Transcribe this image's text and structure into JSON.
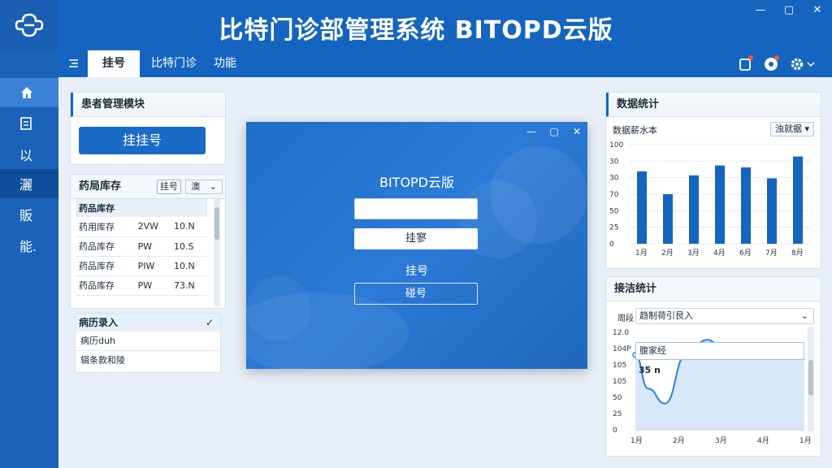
{
  "app": {
    "title": "比特门诊部管理系统 BITOPD云版"
  },
  "window_controls": {
    "minimize": "—",
    "maximize": "▢",
    "close": "✕"
  },
  "tabs": [
    {
      "label": "挂号",
      "active": true
    },
    {
      "label": "比特门诊",
      "active": false
    },
    {
      "label": "功能",
      "active": false
    }
  ],
  "nav": [
    {
      "label": "",
      "icon": "home-icon"
    },
    {
      "label": "",
      "icon": "document-icon"
    },
    {
      "label": "以"
    },
    {
      "label": "灑"
    },
    {
      "label": "販"
    },
    {
      "label": "能."
    }
  ],
  "patient_panel": {
    "title": "患者管理模块",
    "button": "挂挂号"
  },
  "pharmacy": {
    "title": "药局库存",
    "btn1": "挂号",
    "btn2": "澳",
    "header": "药品库存",
    "rows": [
      {
        "name": "药用库存",
        "unit": "2VW",
        "qty": "10.N"
      },
      {
        "name": "药品库存",
        "unit": "PW",
        "qty": "10.S"
      },
      {
        "name": "药品库存",
        "unit": "PIW",
        "qty": "10.N"
      },
      {
        "name": "药品库存",
        "unit": "PW",
        "qty": "73.N"
      }
    ]
  },
  "records": {
    "title": "病历录入",
    "check": "✓",
    "items": [
      "病历duh",
      "辑条款和陵"
    ]
  },
  "dialog": {
    "title": "BITOPD云版",
    "confirm": "挂寥",
    "label": "挂号",
    "outline_button": "碰号"
  },
  "stats": {
    "title": "数据统计",
    "bar_chart_title": "数据薪水本",
    "dropdown": "浊就据"
  },
  "trend": {
    "title": "接洁统计",
    "select_prefix": "周段",
    "select_value": "趋制荷引艮入",
    "tooltip": "腹家经",
    "marker": "35 n"
  },
  "chart_data": [
    {
      "type": "bar",
      "title": "数据薪水本",
      "categories": [
        "1月",
        "2月",
        "3月",
        "4月",
        "6月",
        "7月",
        "8月"
      ],
      "values": [
        73,
        50,
        69,
        79,
        77,
        66,
        88
      ],
      "yticks": [
        "100",
        "30",
        "30",
        "70",
        "50",
        "25",
        "0"
      ],
      "ylim": [
        0,
        100
      ],
      "color": "#1565c0"
    },
    {
      "type": "area",
      "categories": [
        "1月",
        "2月",
        "3月",
        "4月",
        "1月"
      ],
      "x": [
        0,
        0.3,
        0.7,
        1.2,
        1.7,
        2.2,
        2.6,
        3.0,
        3.4,
        3.6,
        3.8,
        4.0
      ],
      "y": [
        100,
        55,
        35,
        100,
        120,
        98,
        98,
        102,
        112,
        110,
        110,
        110
      ],
      "yticks": [
        "12.0",
        "104P",
        "105",
        "105",
        "50",
        "25",
        "0"
      ],
      "color": "#2f7ed6"
    }
  ],
  "colors": {
    "brand": "#1565c0",
    "nav": "#1a63b8",
    "panel_border": "#d6e0eb"
  }
}
